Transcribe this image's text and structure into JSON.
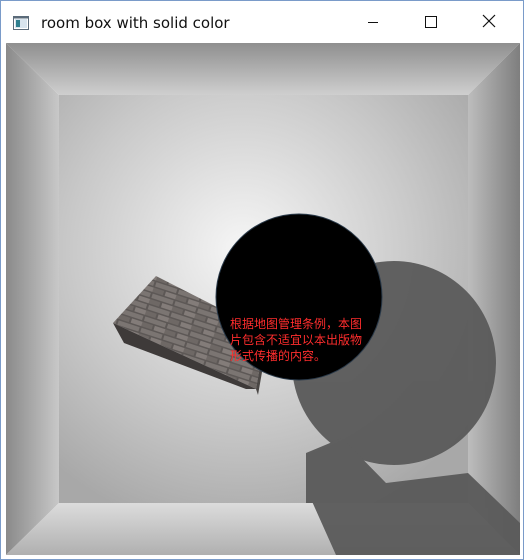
{
  "window": {
    "title": "room box with solid color"
  },
  "titlebar": {
    "app_icon": "app-window-icon",
    "minimize_icon": "minimize-icon",
    "maximize_icon": "maximize-icon",
    "close_icon": "close-icon"
  },
  "scene": {
    "notice_text": "根据地图管理条例，本图片包含不适宜以本出版物形式传播的内容。",
    "colors": {
      "notice": "#ff2d2d",
      "circle": "#000000",
      "shadow": "#5a5a5a"
    }
  }
}
